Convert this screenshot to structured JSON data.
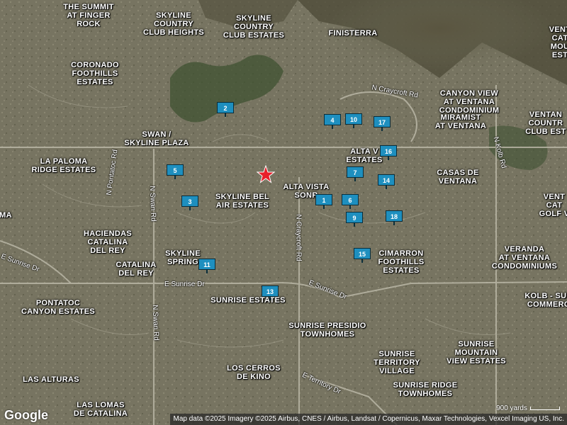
{
  "map": {
    "area_labels": [
      {
        "id": "summit",
        "lines": [
          "THE SUMMIT",
          "AT FINGER",
          "ROCK"
        ]
      },
      {
        "id": "skyline-heights",
        "lines": [
          "SKYLINE",
          "COUNTRY",
          "CLUB HEIGHTS"
        ]
      },
      {
        "id": "skyline-estates",
        "lines": [
          "SKYLINE",
          "COUNTRY",
          "CLUB ESTATES"
        ]
      },
      {
        "id": "finisterra",
        "lines": [
          "FINISTERRA"
        ]
      },
      {
        "id": "ventana-top",
        "lines": [
          "VENT",
          "CAT",
          "MOU",
          "EST"
        ]
      },
      {
        "id": "coronado",
        "lines": [
          "CORONADO",
          "FOOTHILLS",
          "ESTATES"
        ]
      },
      {
        "id": "canyon-view",
        "lines": [
          "CANYON VIEW",
          "AT VENTANA",
          "CONDOMINIUM"
        ]
      },
      {
        "id": "miramist",
        "lines": [
          "MIRAMIST",
          "AT VENTANA"
        ]
      },
      {
        "id": "ventana-cc",
        "lines": [
          "VENTAN",
          "COUNTR",
          "CLUB EST"
        ]
      },
      {
        "id": "swan-skyline",
        "lines": [
          "SWAN /",
          "SKYLINE PLAZA"
        ]
      },
      {
        "id": "la-paloma",
        "lines": [
          "LA PALOMA",
          "RIDGE ESTATES"
        ]
      },
      {
        "id": "alta-vista-estates",
        "lines": [
          "ALTA V",
          "ESTATES"
        ]
      },
      {
        "id": "casas",
        "lines": [
          "CASAS DE",
          "VENTANA"
        ]
      },
      {
        "id": "skyline-bel",
        "lines": [
          "SKYLINE BEL",
          "AIR ESTATES"
        ]
      },
      {
        "id": "alta-vista-sonr",
        "lines": [
          "ALTA VISTA",
          "SONR"
        ]
      },
      {
        "id": "vent-golf",
        "lines": [
          "VENT",
          "CAT",
          "GOLF V"
        ]
      },
      {
        "id": "ma",
        "lines": [
          "MA"
        ]
      },
      {
        "id": "haciendas",
        "lines": [
          "HACIENDAS",
          "CATALINA",
          "DEL REY"
        ]
      },
      {
        "id": "catalina-del-rey",
        "lines": [
          "CATALINA",
          "DEL REY"
        ]
      },
      {
        "id": "skyline-spring",
        "lines": [
          "SKYLINE",
          "SPRING"
        ]
      },
      {
        "id": "cimarron",
        "lines": [
          "CIMARRON",
          "FOOTHILLS",
          "ESTATES"
        ]
      },
      {
        "id": "veranda",
        "lines": [
          "VERANDA",
          "AT VENTANA",
          "CONDOMINIUMS"
        ]
      },
      {
        "id": "pontatoc",
        "lines": [
          "PONTATOC",
          "CANYON ESTATES"
        ]
      },
      {
        "id": "sunrise-estates",
        "lines": [
          "SUNRISE ESTATES"
        ]
      },
      {
        "id": "kolb-sun",
        "lines": [
          "KOLB - SUN",
          "COMMERC"
        ]
      },
      {
        "id": "presidio",
        "lines": [
          "SUNRISE PRESIDIO",
          "TOWNHOMES"
        ]
      },
      {
        "id": "sunrise-mountain",
        "lines": [
          "SUNRISE",
          "MOUNTAIN",
          "VIEW ESTATES"
        ]
      },
      {
        "id": "territory",
        "lines": [
          "SUNRISE",
          "TERRITORY",
          "VILLAGE"
        ]
      },
      {
        "id": "cerros",
        "lines": [
          "LOS CERROS",
          "DE KINO"
        ]
      },
      {
        "id": "las-alturas",
        "lines": [
          "LAS ALTURAS"
        ]
      },
      {
        "id": "ridge-townhomes",
        "lines": [
          "SUNRISE RIDGE",
          "TOWNHOMES"
        ]
      },
      {
        "id": "las-lomas",
        "lines": [
          "LAS LOMAS",
          "DE CATALINA"
        ]
      }
    ],
    "road_labels": [
      {
        "id": "craycroft-n",
        "text": "N Craycroft Rd"
      },
      {
        "id": "pontatoc",
        "text": "N Pontatoc Rd"
      },
      {
        "id": "swan-n",
        "text": "N Swan Rd"
      },
      {
        "id": "craycroft-s",
        "text": "N Craycroft Rd"
      },
      {
        "id": "kolb",
        "text": "N Kolb Rd"
      },
      {
        "id": "sunrise-w",
        "text": "E Sunrise Dr"
      },
      {
        "id": "sunrise-e",
        "text": "E Sunrise Dr"
      },
      {
        "id": "sunrise-far",
        "text": "E Sunrise Dr"
      },
      {
        "id": "swan-s",
        "text": "N Swan Rd"
      },
      {
        "id": "territory",
        "text": "E Territory Dr"
      }
    ],
    "markers": [
      "1",
      "2",
      "3",
      "4",
      "5",
      "6",
      "7",
      "9",
      "10",
      "11",
      "13",
      "14",
      "15",
      "16",
      "17",
      "18"
    ],
    "marker_color": "#1e8fbf",
    "star_color": "#e8202a",
    "logo": "Google",
    "attribution": "Map data ©2025 Imagery ©2025 Airbus, CNES / Airbus, Landsat / Copernicus, Maxar Technologies, Vexcel Imaging US, Inc.",
    "scale": "900 yards"
  }
}
